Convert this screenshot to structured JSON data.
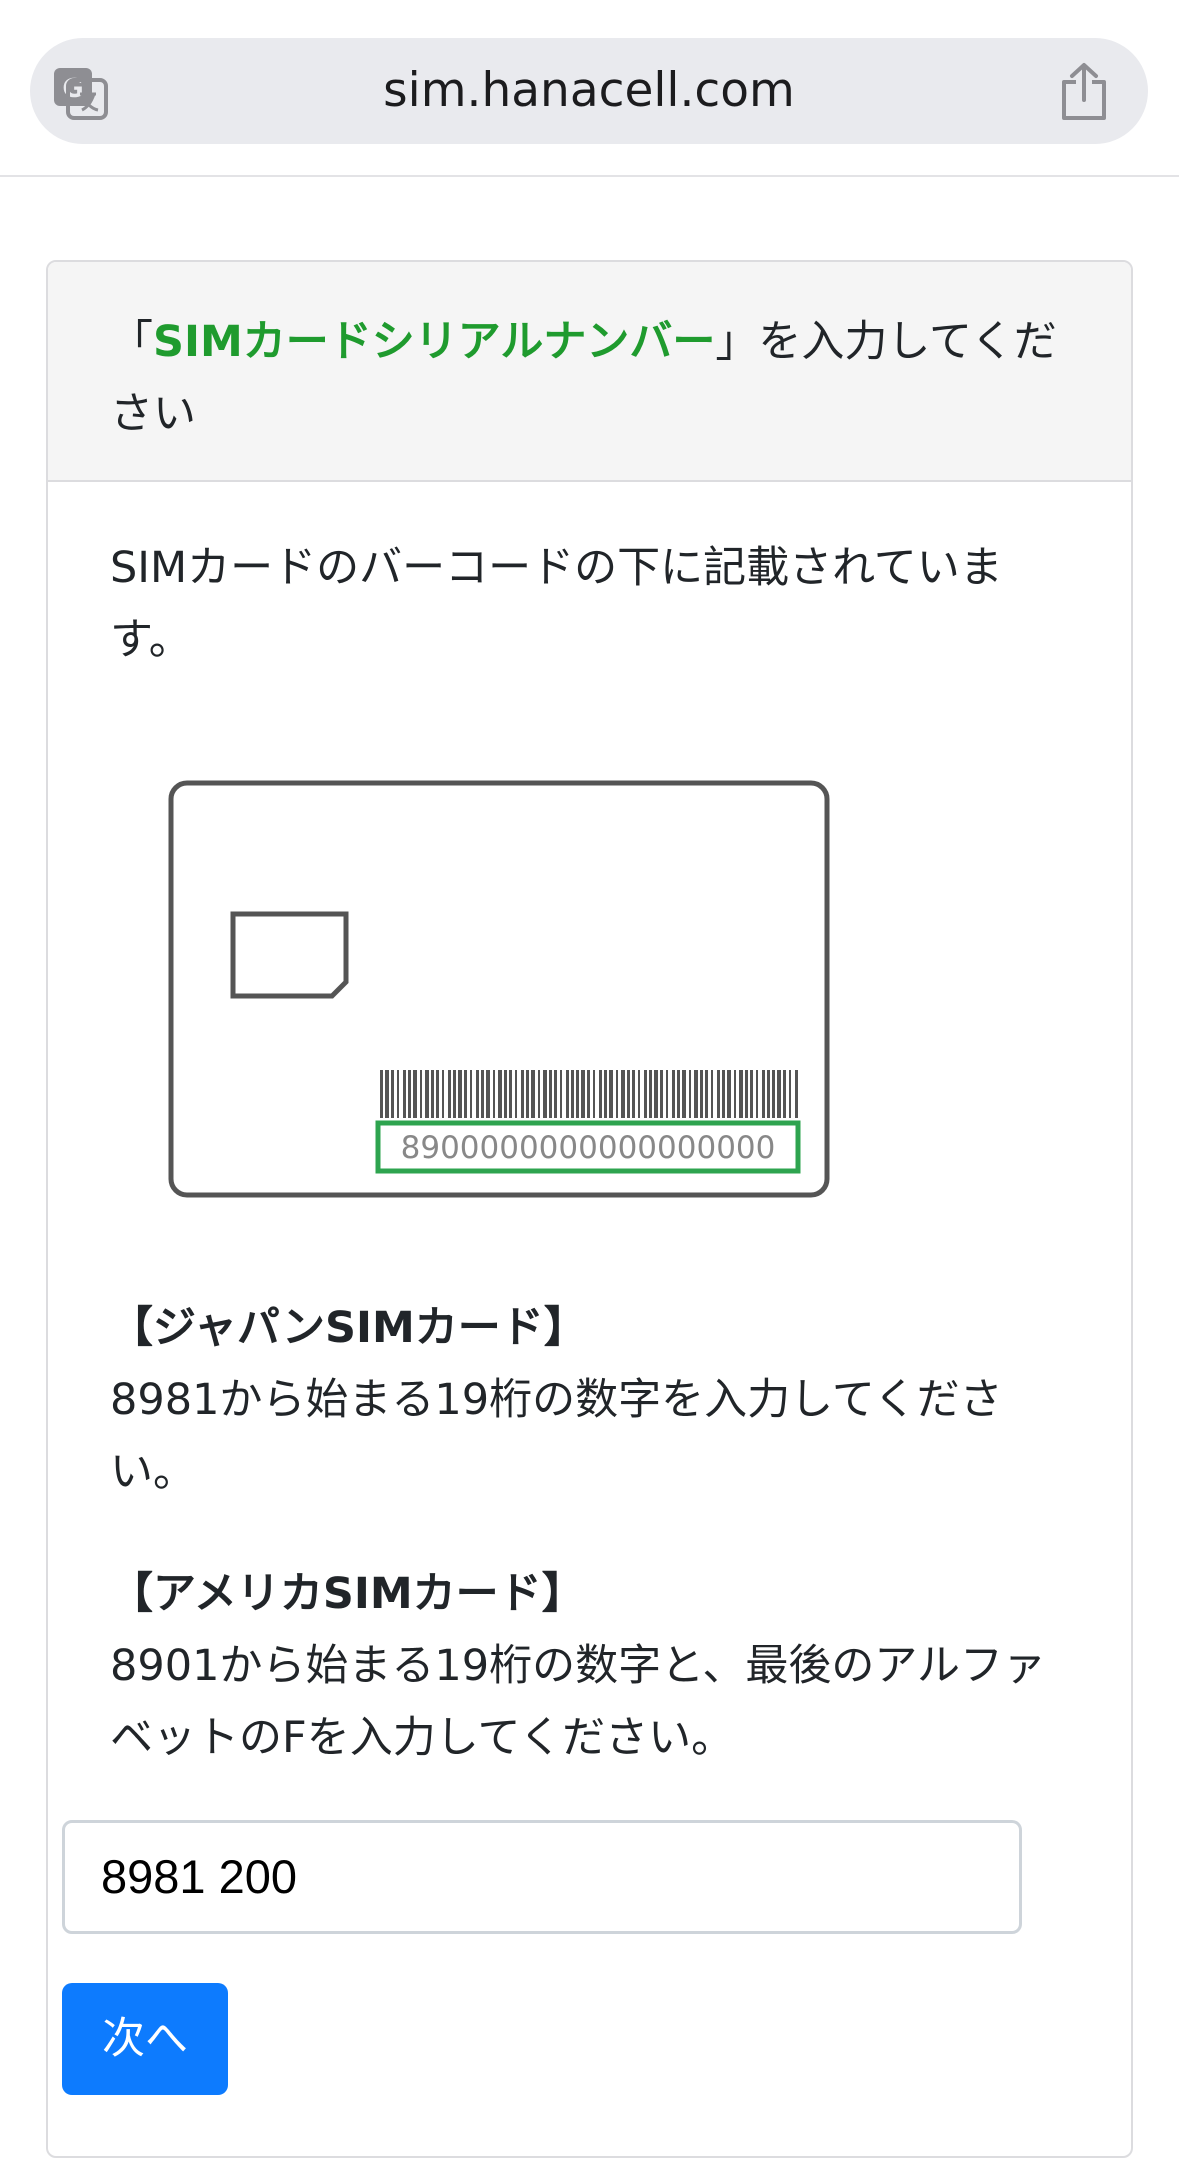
{
  "browser": {
    "url": "sim.hanacell.com",
    "translate_icon": "translate-icon",
    "share_icon": "share-icon"
  },
  "card": {
    "header": {
      "open_bracket": "「",
      "highlight": "SIMカードシリアルナンバー",
      "rest_line1": "」を入力してくだ",
      "rest_line2": "さい",
      "highlight_color": "#1f9b2e"
    },
    "intro": {
      "line1": "SIMカードのバーコードの下に記載されていま",
      "line2": "す。"
    },
    "illustration": {
      "serial_sample": "8900000000000000000",
      "highlight_color": "#2ea44f"
    },
    "japan": {
      "title": "【ジャパンSIMカード】",
      "line1": "8981から始まる19桁の数字を入力してくださ",
      "line2": "い。"
    },
    "america": {
      "title": "【アメリカSIMカード】",
      "line1": "8901から始まる19桁の数字と、最後のアルファ",
      "line2": "ベットのFを入力してください。"
    },
    "input": {
      "value": "8981 200"
    },
    "next_button": {
      "label": "次へ",
      "color": "#0d7bfe"
    }
  }
}
